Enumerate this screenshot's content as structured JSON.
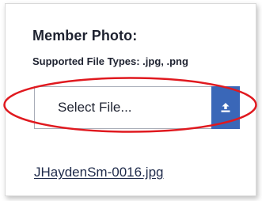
{
  "card": {
    "title": "Member Photo:",
    "subtitle": "Supported File Types: .jpg, .png"
  },
  "upload": {
    "button_label": "Select File...",
    "icon": "upload-icon"
  },
  "uploaded_file": {
    "name": "JHaydenSm-0016.jpg"
  },
  "colors": {
    "accent": "#3a67b8",
    "highlight": "#e0191f",
    "text": "#1e2230"
  }
}
